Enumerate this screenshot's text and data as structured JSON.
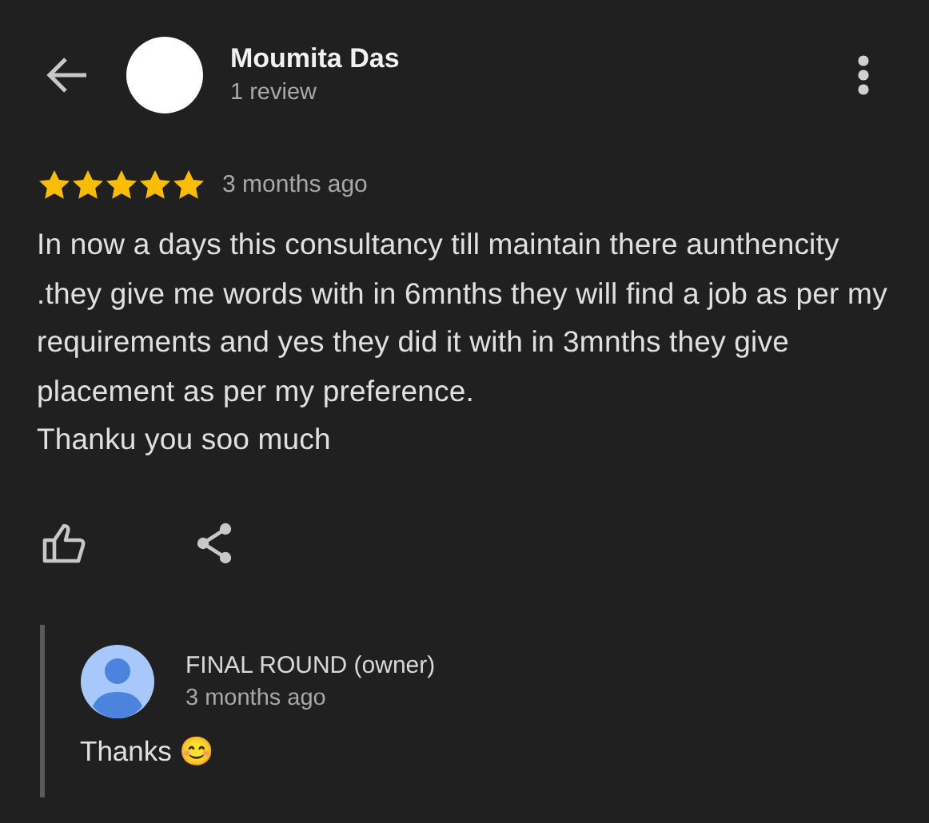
{
  "review": {
    "author": "Moumita Das",
    "author_meta": "1 review",
    "stars": 5,
    "time": "3 months ago",
    "text": "In now a days this consultancy till maintain there aunthencity .they give me words with in 6mnths they will find a job as per my requirements and yes they did it with in 3mnths they give placement as per my preference.\nThanku you soo much"
  },
  "reply": {
    "author": "FINAL ROUND (owner)",
    "time": "3 months ago",
    "text": "Thanks 😊"
  }
}
